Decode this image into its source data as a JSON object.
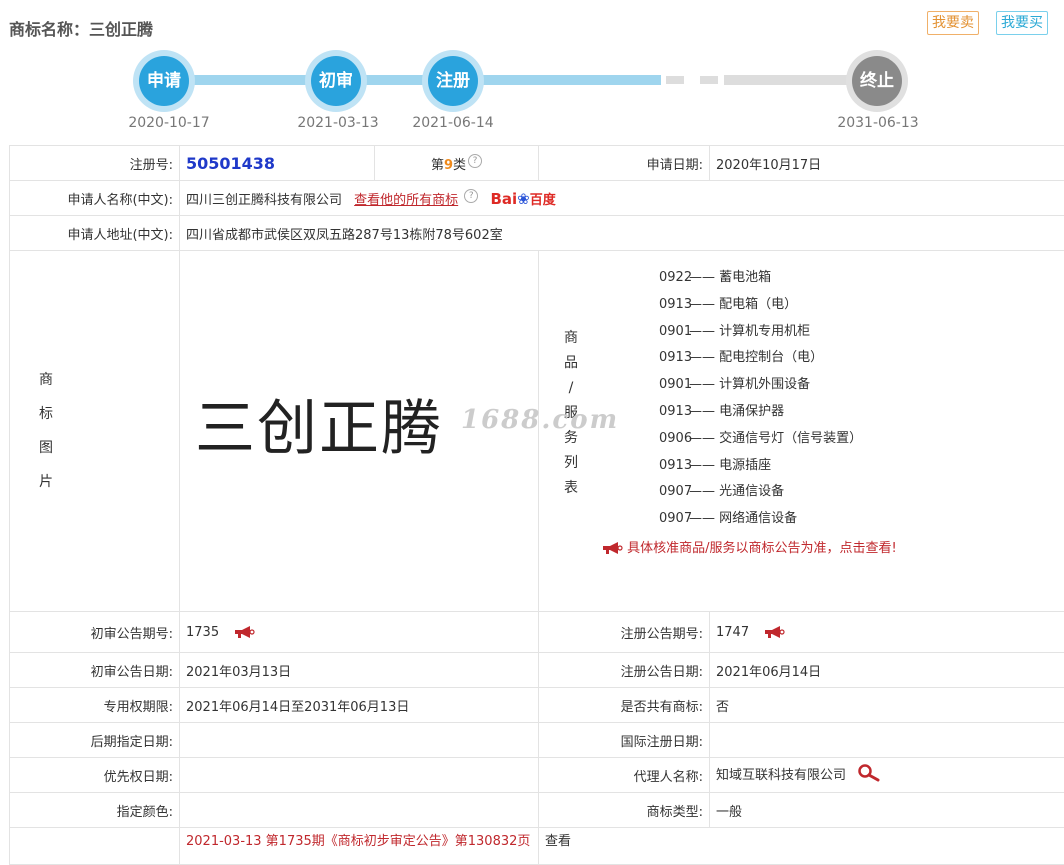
{
  "header": {
    "title": "商标名称：三创正腾",
    "sell_label": "我要卖",
    "buy_label": "我要买"
  },
  "timeline": [
    {
      "label": "申请",
      "date": "2020-10-17"
    },
    {
      "label": "初审",
      "date": "2021-03-13"
    },
    {
      "label": "注册",
      "date": "2021-06-14"
    },
    {
      "label": "终止",
      "date": "2031-06-13"
    }
  ],
  "info": {
    "reg_no_label": "注册号:",
    "reg_no": "50501438",
    "class_prefix": "第",
    "class_num": "9",
    "class_suffix": "类",
    "apply_date_label": "申请日期:",
    "apply_date": "2020年10月17日",
    "applicant_label": "申请人名称(中文):",
    "applicant": "四川三创正腾科技有限公司",
    "view_all_link": "查看他的所有商标",
    "baidu_a": "Bai",
    "baidu_b": "百度",
    "address_label": "申请人地址(中文):",
    "address": "四川省成都市武侯区双凤五路287号13栋附78号602室",
    "image_label_chars": [
      "商",
      "标",
      "图",
      "片"
    ],
    "mark_text": "三创正腾",
    "watermark": "1688.com",
    "goods_label_chars": [
      "商",
      "品",
      "/",
      "服",
      "务",
      "列",
      "表"
    ],
    "goods": [
      {
        "code": "0922",
        "sep": "——",
        "name": "蓄电池箱"
      },
      {
        "code": "0913",
        "sep": "——",
        "name": "配电箱（电）"
      },
      {
        "code": "0901",
        "sep": "——",
        "name": "计算机专用机柜"
      },
      {
        "code": "0913",
        "sep": "——",
        "name": "配电控制台（电）"
      },
      {
        "code": "0901",
        "sep": "——",
        "name": "计算机外围设备"
      },
      {
        "code": "0913",
        "sep": "——",
        "name": "电涌保护器"
      },
      {
        "code": "0906",
        "sep": "——",
        "name": "交通信号灯（信号装置）"
      },
      {
        "code": "0913",
        "sep": "——",
        "name": "电源插座"
      },
      {
        "code": "0907",
        "sep": "——",
        "name": "光通信设备"
      },
      {
        "code": "0907",
        "sep": "——",
        "name": "网络通信设备"
      }
    ],
    "goods_notice": "具体核准商品/服务以商标公告为准，点击查看!",
    "prelim_no_label": "初审公告期号:",
    "prelim_no": "1735",
    "reg_pub_no_label": "注册公告期号:",
    "reg_pub_no": "1747",
    "prelim_date_label": "初审公告日期:",
    "prelim_date": "2021年03月13日",
    "reg_pub_date_label": "注册公告日期:",
    "reg_pub_date": "2021年06月14日",
    "term_label": "专用权期限:",
    "term": "2021年06月14日至2031年06月13日",
    "shared_label": "是否共有商标:",
    "shared": "否",
    "later_date_label": "后期指定日期:",
    "later_date": "",
    "intl_date_label": "国际注册日期:",
    "intl_date": "",
    "priority_label": "优先权日期:",
    "priority": "",
    "agent_label": "代理人名称:",
    "agent": "知域互联科技有限公司",
    "color_label": "指定颜色:",
    "color": "",
    "type_label": "商标类型:",
    "type": "一般",
    "bottom_row_text": "2021-03-13 第1735期《商标初步审定公告》第130832页",
    "bottom_view": "查看"
  },
  "colors": {
    "accent_blue": "#2aa3dd",
    "red": "#c0282d",
    "regno_blue": "#1f39c9",
    "orange": "#f08a1b"
  }
}
